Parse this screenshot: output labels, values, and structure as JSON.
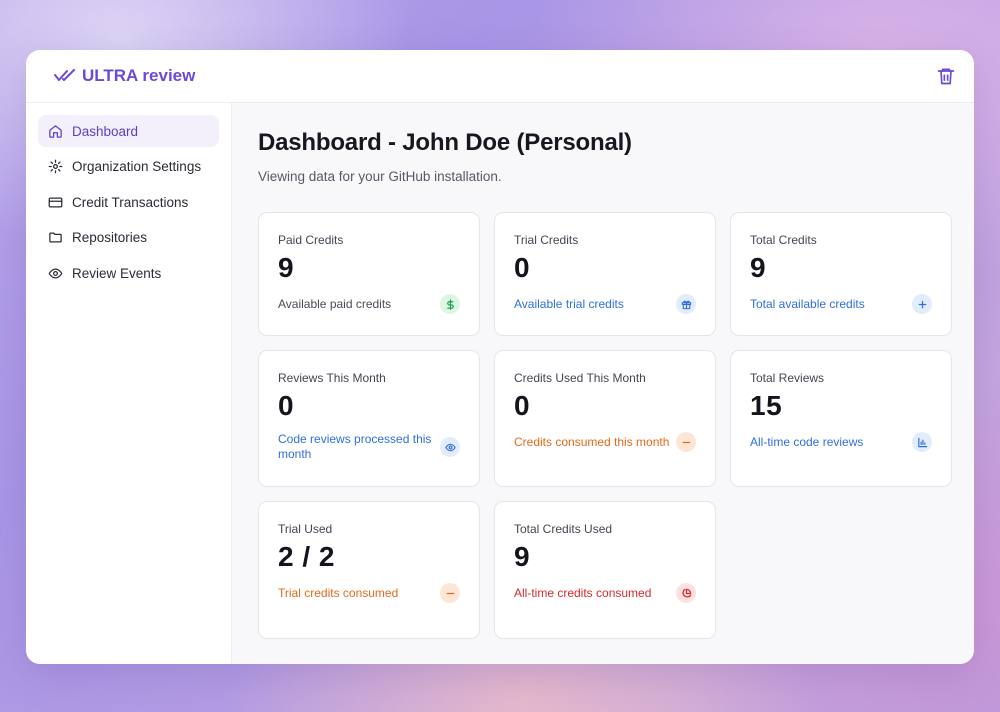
{
  "app": {
    "brand": "ULTRA review"
  },
  "sidebar": {
    "items": [
      {
        "label": "Dashboard",
        "icon": "home-icon",
        "active": true
      },
      {
        "label": "Organization Settings",
        "icon": "gear-icon"
      },
      {
        "label": "Credit Transactions",
        "icon": "credit-card-icon"
      },
      {
        "label": "Repositories",
        "icon": "folder-icon"
      },
      {
        "label": "Review Events",
        "icon": "eye-icon"
      }
    ]
  },
  "main": {
    "title": "Dashboard - John Doe (Personal)",
    "subtitle": "Viewing data for your GitHub installation.",
    "cards": [
      {
        "label": "Paid Credits",
        "value": "9",
        "description": "Available paid credits",
        "icon": "dollar-icon",
        "tone": "gray"
      },
      {
        "label": "Trial Credits",
        "value": "0",
        "description": "Available trial credits",
        "icon": "gift-icon",
        "tone": "blue"
      },
      {
        "label": "Total Credits",
        "value": "9",
        "description": "Total available credits",
        "icon": "plus-icon",
        "tone": "blue"
      },
      {
        "label": "Reviews This Month",
        "value": "0",
        "description": "Code reviews processed this month",
        "icon": "eye-icon",
        "tone": "blue"
      },
      {
        "label": "Credits Used This Month",
        "value": "0",
        "description": "Credits consumed this month",
        "icon": "minus-icon",
        "tone": "orange"
      },
      {
        "label": "Total Reviews",
        "value": "15",
        "description": "All-time code reviews",
        "icon": "bar-chart-icon",
        "tone": "blue"
      },
      {
        "label": "Trial Used",
        "value": "2 / 2",
        "description": "Trial credits consumed",
        "icon": "minus-icon",
        "tone": "orange"
      },
      {
        "label": "Total Credits Used",
        "value": "9",
        "description": "All-time credits consumed",
        "icon": "pie-chart-icon",
        "tone": "red"
      }
    ]
  },
  "colors": {
    "accent": "#6b49d8",
    "blue": "#2f6fe0",
    "orange": "#e36a1c",
    "red": "#d72a2a",
    "green": "#1f9b50"
  }
}
